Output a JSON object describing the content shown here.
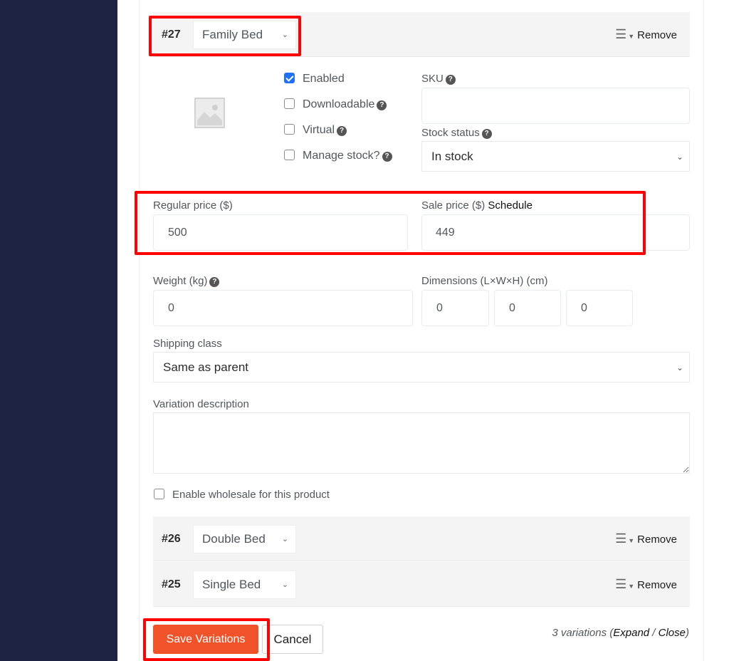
{
  "variations": {
    "expanded": {
      "id": "#27",
      "attribute": "Family Bed",
      "remove_label": "Remove",
      "checkboxes": {
        "enabled": {
          "label": "Enabled",
          "checked": true
        },
        "downloadable": {
          "label": "Downloadable",
          "checked": false
        },
        "virtual": {
          "label": "Virtual",
          "checked": false
        },
        "manage_stock": {
          "label": "Manage stock?",
          "checked": false
        }
      },
      "sku": {
        "label": "SKU",
        "value": ""
      },
      "stock_status": {
        "label": "Stock status",
        "value": "In stock"
      },
      "regular_price": {
        "label": "Regular price ($)",
        "value": "500"
      },
      "sale_price": {
        "label": "Sale price ($)",
        "schedule_link": "Schedule",
        "value": "449"
      },
      "weight": {
        "label": "Weight (kg)",
        "value": "0"
      },
      "dimensions": {
        "label": "Dimensions (L×W×H) (cm)",
        "length": "0",
        "width": "0",
        "height": "0"
      },
      "shipping_class": {
        "label": "Shipping class",
        "value": "Same as parent"
      },
      "description": {
        "label": "Variation description",
        "value": ""
      },
      "wholesale": {
        "label": "Enable wholesale for this product",
        "checked": false
      }
    },
    "collapsed": [
      {
        "id": "#26",
        "attribute": "Double Bed",
        "remove_label": "Remove"
      },
      {
        "id": "#25",
        "attribute": "Single Bed",
        "remove_label": "Remove"
      }
    ]
  },
  "footer": {
    "save_label": "Save Variations",
    "cancel_label": "Cancel",
    "count_text": "3 variations (",
    "expand_label": "Expand",
    "separator": " / ",
    "close_label": "Close",
    "count_end": ")"
  },
  "icons": {
    "help": "?",
    "menu": "☰",
    "caret": "▼",
    "chevron": "⌄"
  },
  "colors": {
    "accent": "#f0532a",
    "sidebar": "#1d2340",
    "checkbox": "#2271f5",
    "highlight": "#ff0000"
  }
}
